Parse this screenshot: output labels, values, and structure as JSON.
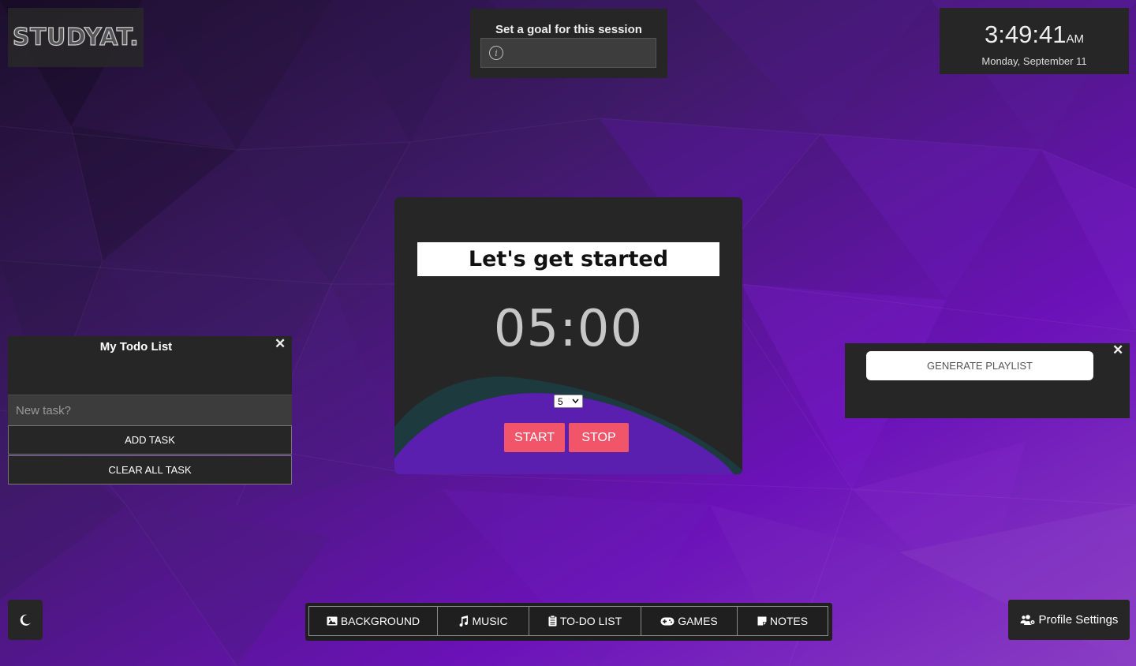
{
  "logo": {
    "text": "STUDYAT."
  },
  "goal": {
    "title": "Set a goal for this session",
    "input_value": ""
  },
  "clock": {
    "time": "3:49:41",
    "ampm": "AM",
    "date": "Monday, September 11"
  },
  "timer": {
    "title": "Let's get started",
    "display": "05:00",
    "minutes_selected": "5",
    "start_label": "START",
    "stop_label": "STOP"
  },
  "todo": {
    "title": "My Todo List",
    "close": "✕",
    "input_placeholder": "New task?",
    "add_label": "ADD TASK",
    "clear_label": "CLEAR ALL TASK"
  },
  "playlist": {
    "button_label": "GENERATE PLAYLIST",
    "close": "✕"
  },
  "nav": {
    "items": [
      {
        "label": "BACKGROUND",
        "icon": "image-icon"
      },
      {
        "label": "MUSIC",
        "icon": "music-icon"
      },
      {
        "label": "TO-DO LIST",
        "icon": "clipboard-icon"
      },
      {
        "label": "GAMES",
        "icon": "gamepad-icon"
      },
      {
        "label": "NOTES",
        "icon": "sticky-note-icon"
      }
    ]
  },
  "profile": {
    "label": "Profile Settings",
    "icon": "users-gear-icon"
  },
  "theme_toggle": {
    "icon": "moon-icon"
  },
  "colors": {
    "accent_button": "#f0556a",
    "panel": "#262626",
    "wave_front": "#5b1fb0",
    "wave_back": "#1d3a3e",
    "background_base": "#3a1a5e"
  }
}
